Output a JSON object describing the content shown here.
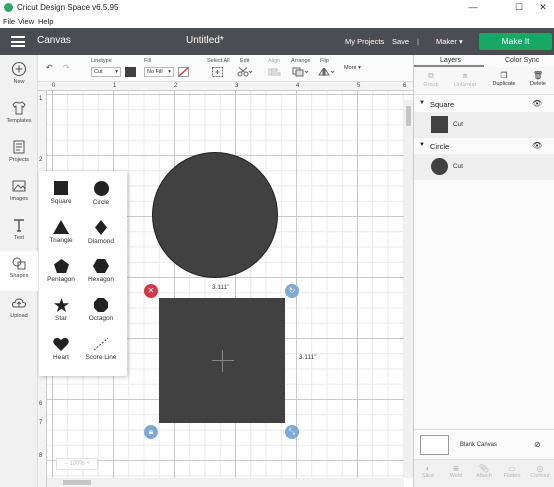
{
  "window": {
    "title": "Cricut Design Space  v6.5.95",
    "minimize": "—",
    "maximize": "☐",
    "close": "✕"
  },
  "menu": {
    "items": [
      "File",
      "View",
      "Help"
    ]
  },
  "header": {
    "section": "Canvas",
    "project_title": "Untitled*",
    "my_projects": "My Projects",
    "save": "Save",
    "separator": "|",
    "machine": "Maker",
    "make_it": "Make It"
  },
  "toolbar": {
    "linetype_label": "Linetype",
    "linetype_value": "Cut",
    "fill_label": "Fill",
    "fill_value": "No Fill",
    "select_all": "Select All",
    "edit": "Edit",
    "align": "Align",
    "arrange": "Arrange",
    "flip": "Flip",
    "more": "More"
  },
  "sidebar": {
    "items": [
      {
        "label": "New",
        "icon": "plus-circle-icon"
      },
      {
        "label": "Templates",
        "icon": "tshirt-icon"
      },
      {
        "label": "Projects",
        "icon": "projects-icon"
      },
      {
        "label": "Images",
        "icon": "image-icon"
      },
      {
        "label": "Text",
        "icon": "text-icon"
      },
      {
        "label": "Shapes",
        "icon": "shapes-icon"
      },
      {
        "label": "Upload",
        "icon": "cloud-upload-icon"
      }
    ]
  },
  "ruler": {
    "top": [
      "0",
      "1",
      "2",
      "3",
      "4",
      "5",
      "6"
    ],
    "left": [
      "1",
      "2",
      "3",
      "4",
      "5",
      "6",
      "7",
      "8"
    ]
  },
  "canvas": {
    "width_label": "3.111\"",
    "height_label": "3.111\"",
    "zoom": "100%",
    "shape_color": "#414141"
  },
  "shapes_panel": {
    "items": [
      "Square",
      "Circle",
      "Triangle",
      "Diamond",
      "Pentagon",
      "Hexagon",
      "Star",
      "Octagon",
      "Heart",
      "Score Line"
    ]
  },
  "layers_panel": {
    "tabs": [
      "Layers",
      "Color Sync"
    ],
    "actions": [
      "Group",
      "UnGroup",
      "Duplicate",
      "Delete"
    ],
    "groups": [
      {
        "name": "Square",
        "row_label": "Cut"
      },
      {
        "name": "Circle",
        "row_label": "Cut"
      }
    ],
    "blank_canvas": "Blank Canvas",
    "bottom_actions": [
      "Slice",
      "Weld",
      "Attach",
      "Flatten",
      "Contour"
    ]
  },
  "colors": {
    "header_bg": "#4a4d51",
    "make_it": "#18a866",
    "delete_handle": "#d1394a",
    "handle_blue": "#7ea8d6"
  }
}
